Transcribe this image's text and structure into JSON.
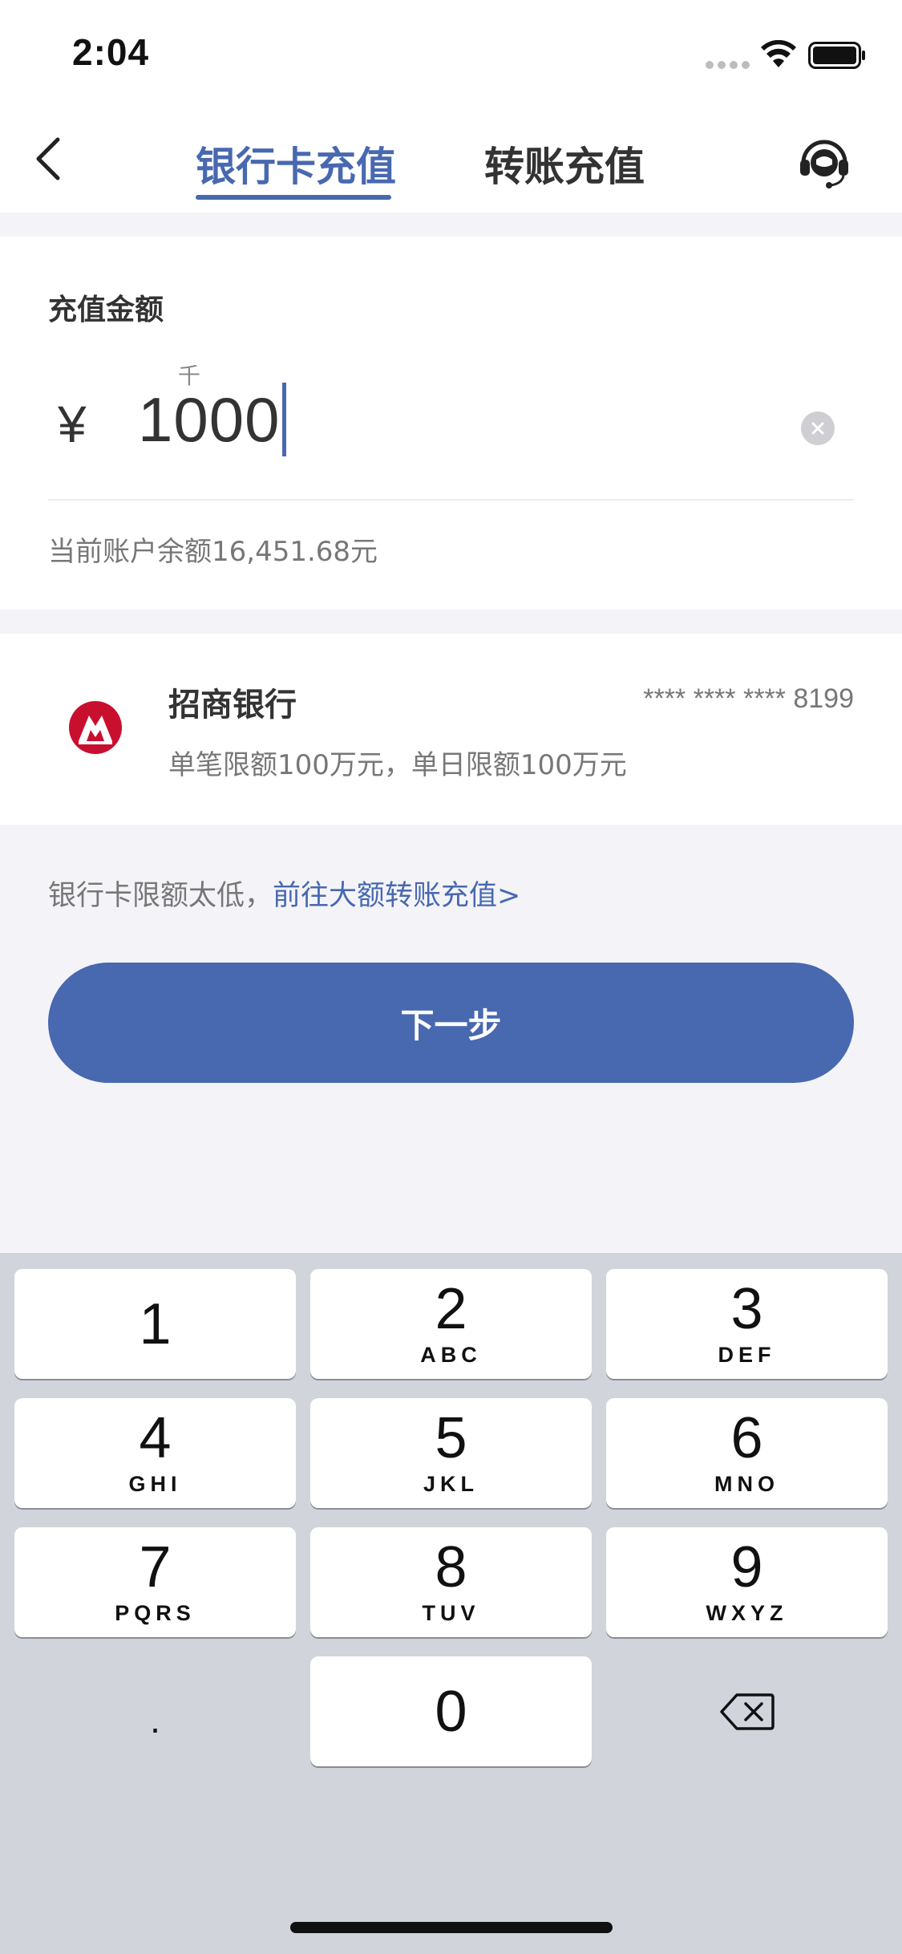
{
  "status_bar": {
    "time": "2:04",
    "icons": [
      "signal-dots-icon",
      "wifi-icon",
      "battery-icon"
    ]
  },
  "nav": {
    "back_icon": "chevron-left-icon",
    "tabs": [
      {
        "label": "银行卡充值",
        "active": true
      },
      {
        "label": "转账充值",
        "active": false
      }
    ],
    "support_icon": "headset-icon"
  },
  "amount": {
    "label": "充值金额",
    "currency_symbol": "¥",
    "unit_hint": "千",
    "value": "1000",
    "clear_icon": "clear-icon",
    "balance_text": "当前账户余额16,451.68元"
  },
  "bank_card": {
    "logo_icon": "cmb-bank-logo-icon",
    "name": "招商银行",
    "card_number": "**** **** **** 8199",
    "limit_text": "单笔限额100万元，单日限额100万元"
  },
  "tip": {
    "text": "银行卡限额太低，",
    "link": "前往大额转账充值>"
  },
  "next_button": {
    "label": "下一步"
  },
  "keyboard": {
    "keys": [
      {
        "digit": "1",
        "letters": ""
      },
      {
        "digit": "2",
        "letters": "ABC"
      },
      {
        "digit": "3",
        "letters": "DEF"
      },
      {
        "digit": "4",
        "letters": "GHI"
      },
      {
        "digit": "5",
        "letters": "JKL"
      },
      {
        "digit": "6",
        "letters": "MNO"
      },
      {
        "digit": "7",
        "letters": "PQRS"
      },
      {
        "digit": "8",
        "letters": "TUV"
      },
      {
        "digit": "9",
        "letters": "WXYZ"
      },
      {
        "digit": ".",
        "letters": ""
      },
      {
        "digit": "0",
        "letters": ""
      },
      {
        "digit": "",
        "letters": ""
      }
    ],
    "delete_icon": "backspace-icon"
  },
  "colors": {
    "accent": "#4868b0",
    "background": "#f4f4f8",
    "keyboard_background": "#d1d4db",
    "bank_logo_red": "#c8102e"
  }
}
